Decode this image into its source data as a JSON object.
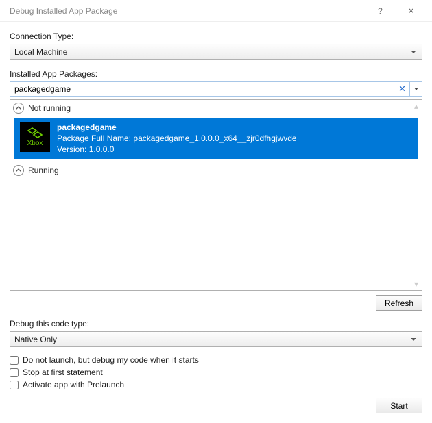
{
  "window": {
    "title": "Debug Installed App Package",
    "help_icon": "?",
    "close_icon": "✕"
  },
  "labels": {
    "connection_type": "Connection Type:",
    "installed_packages": "Installed App Packages:",
    "debug_code_type": "Debug this code type:"
  },
  "connection_type": {
    "selected": "Local Machine"
  },
  "search": {
    "value": "packagedgame"
  },
  "groups": {
    "not_running": "Not running",
    "running": "Running"
  },
  "package": {
    "name": "packagedgame",
    "full_name_label": "Package Full Name:",
    "full_name": "packagedgame_1.0.0.0_x64__zjr0dfhgjwvde",
    "version_label": "Version:",
    "version": "1.0.0.0",
    "platform_icon_label": "Xbox"
  },
  "debug_code_type": {
    "selected": "Native Only"
  },
  "checkboxes": {
    "do_not_launch": "Do not launch, but debug my code when it starts",
    "stop_first": "Stop at first statement",
    "prelaunch": "Activate app with Prelaunch"
  },
  "buttons": {
    "refresh": "Refresh",
    "start": "Start"
  }
}
